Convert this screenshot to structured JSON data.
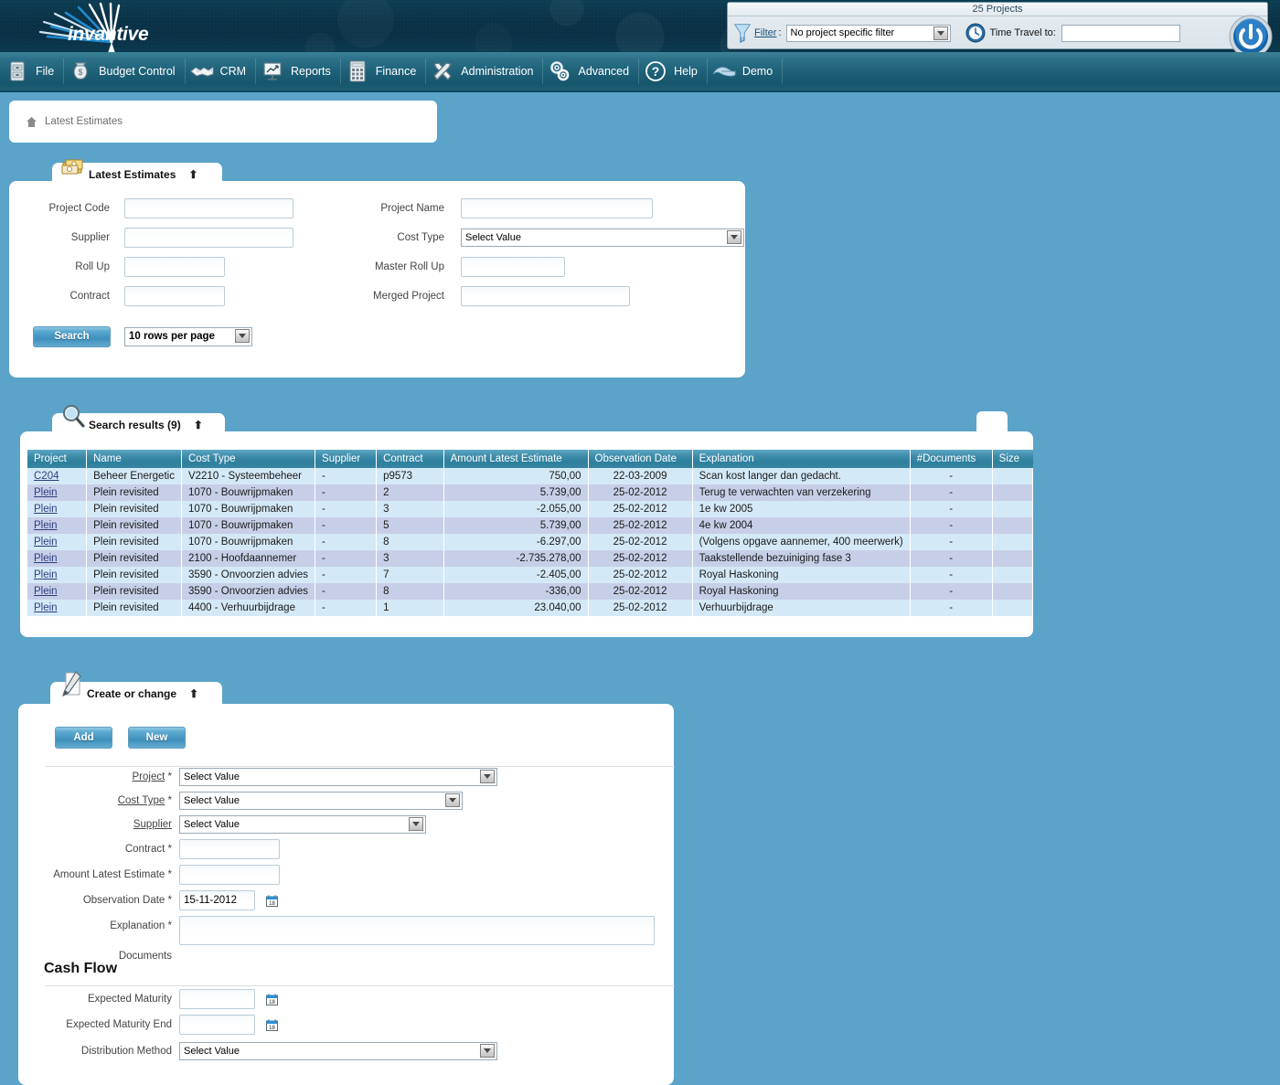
{
  "brand": {
    "name": "invantive",
    "logo_icon": "starburst-logo"
  },
  "topbar": {
    "projects_count": "25 Projects",
    "filter_label": "Filter",
    "filter_colon": ":",
    "filter_value": "No project specific filter",
    "time_travel_label": "Time Travel to:",
    "time_travel_value": "",
    "power_icon": "power-button-icon",
    "funnel_icon": "funnel-filter-icon",
    "clock_icon": "time-travel-clock-icon"
  },
  "menu": [
    {
      "label": "File",
      "icon": "file-cabinet-icon"
    },
    {
      "label": "Budget Control",
      "icon": "money-bag-icon"
    },
    {
      "label": "CRM",
      "icon": "handshake-icon"
    },
    {
      "label": "Reports",
      "icon": "presentation-chart-icon"
    },
    {
      "label": "Finance",
      "icon": "calculator-icon"
    },
    {
      "label": "Administration",
      "icon": "tools-wrench-icon"
    },
    {
      "label": "Advanced",
      "icon": "gears-icon"
    },
    {
      "label": "Help",
      "icon": "question-mark-icon"
    },
    {
      "label": "Demo",
      "icon": "wave-logo-icon"
    }
  ],
  "breadcrumb": {
    "home_icon": "home-icon",
    "text": "Latest Estimates"
  },
  "search_panel": {
    "title": "Latest Estimates",
    "icon": "money-stack-icon",
    "collapse_icon": "chevron-up-icon",
    "fields": {
      "project_code_label": "Project Code",
      "project_code_value": "",
      "project_name_label": "Project Name",
      "project_name_value": "",
      "supplier_label": "Supplier",
      "supplier_value": "",
      "cost_type_label": "Cost Type",
      "cost_type_value": "Select Value",
      "roll_up_label": "Roll Up",
      "roll_up_value": "",
      "master_roll_up_label": "Master Roll Up",
      "master_roll_up_value": "",
      "contract_label": "Contract",
      "contract_value": "",
      "merged_project_label": "Merged Project",
      "merged_project_value": ""
    },
    "search_button": "Search",
    "rows_per_page": "10 rows per page"
  },
  "results_panel": {
    "title": "Search results (9)",
    "icon": "magnifier-icon",
    "collapse_icon": "chevron-up-icon",
    "columns": [
      "Project",
      "Name",
      "Cost Type",
      "Supplier",
      "Contract",
      "Amount Latest Estimate",
      "Observation Date",
      "Explanation",
      "#Documents",
      "Size"
    ],
    "rows": [
      {
        "project": "C204",
        "name": "Beheer Energetic",
        "cost_type": "V2210 - Systeembeheer",
        "supplier": "-",
        "contract": "p9573",
        "amount": "750,00",
        "observation_date": "22-03-2009",
        "explanation": "Scan kost langer dan gedacht.",
        "documents": "-",
        "size": ""
      },
      {
        "project": "Plein",
        "name": "Plein revisited",
        "cost_type": "1070 - Bouwrijpmaken",
        "supplier": "-",
        "contract": "2",
        "amount": "5.739,00",
        "observation_date": "25-02-2012",
        "explanation": "Terug te verwachten van verzekering",
        "documents": "-",
        "size": ""
      },
      {
        "project": "Plein",
        "name": "Plein revisited",
        "cost_type": "1070 - Bouwrijpmaken",
        "supplier": "-",
        "contract": "3",
        "amount": "-2.055,00",
        "observation_date": "25-02-2012",
        "explanation": "1e kw 2005",
        "documents": "-",
        "size": ""
      },
      {
        "project": "Plein",
        "name": "Plein revisited",
        "cost_type": "1070 - Bouwrijpmaken",
        "supplier": "-",
        "contract": "5",
        "amount": "5.739,00",
        "observation_date": "25-02-2012",
        "explanation": "4e kw 2004",
        "documents": "-",
        "size": ""
      },
      {
        "project": "Plein",
        "name": "Plein revisited",
        "cost_type": "1070 - Bouwrijpmaken",
        "supplier": "-",
        "contract": "8",
        "amount": "-6.297,00",
        "observation_date": "25-02-2012",
        "explanation": "(Volgens opgave aannemer, 400 meerwerk)",
        "documents": "-",
        "size": ""
      },
      {
        "project": "Plein",
        "name": "Plein revisited",
        "cost_type": "2100 - Hoofdaannemer",
        "supplier": "-",
        "contract": "3",
        "amount": "-2.735.278,00",
        "observation_date": "25-02-2012",
        "explanation": "Taakstellende bezuiniging fase 3",
        "documents": "-",
        "size": ""
      },
      {
        "project": "Plein",
        "name": "Plein revisited",
        "cost_type": "3590 - Onvoorzien advies",
        "supplier": "-",
        "contract": "7",
        "amount": "-2.405,00",
        "observation_date": "25-02-2012",
        "explanation": "Royal Haskoning",
        "documents": "-",
        "size": ""
      },
      {
        "project": "Plein",
        "name": "Plein revisited",
        "cost_type": "3590 - Onvoorzien advies",
        "supplier": "-",
        "contract": "8",
        "amount": "-336,00",
        "observation_date": "25-02-2012",
        "explanation": "Royal Haskoning",
        "documents": "-",
        "size": ""
      },
      {
        "project": "Plein",
        "name": "Plein revisited",
        "cost_type": "4400 - Verhuurbijdrage",
        "supplier": "-",
        "contract": "1",
        "amount": "23.040,00",
        "observation_date": "25-02-2012",
        "explanation": "Verhuurbijdrage",
        "documents": "-",
        "size": ""
      }
    ]
  },
  "create_panel": {
    "title": "Create or change",
    "icon": "pencil-document-icon",
    "collapse_icon": "chevron-up-icon",
    "add_button": "Add",
    "new_button": "New",
    "fields": {
      "project_label": "Project",
      "project_required": "*",
      "project_value": "Select Value",
      "cost_type_label": "Cost Type",
      "cost_type_required": "*",
      "cost_type_value": "Select Value",
      "supplier_label": "Supplier",
      "supplier_value": "Select Value",
      "contract_label": "Contract",
      "contract_required": "*",
      "contract_value": "",
      "amount_label": "Amount Latest Estimate",
      "amount_required": "*",
      "amount_value": "",
      "observation_date_label": "Observation Date",
      "observation_date_required": "*",
      "observation_date_value": "15-11-2012",
      "explanation_label": "Explanation",
      "explanation_required": "*",
      "explanation_value": "",
      "documents_label": "Documents"
    },
    "cash_flow_title": "Cash Flow",
    "cash_flow": {
      "expected_maturity_label": "Expected Maturity",
      "expected_maturity_value": "",
      "expected_maturity_end_label": "Expected Maturity End",
      "expected_maturity_end_value": "",
      "distribution_method_label": "Distribution Method",
      "distribution_method_value": "Select Value"
    },
    "calendar_icon": "calendar-picker-icon"
  },
  "colors": {
    "page_background": "#5ba3c9",
    "banner_dark": "#0a3246",
    "menu_teal": "#2c7189",
    "table_header": "#3e8ca9",
    "row_odd": "#d4e9f7",
    "row_even": "#c7cfe8",
    "link": "#2c3f7e",
    "button_blue": "#3f90bd"
  }
}
